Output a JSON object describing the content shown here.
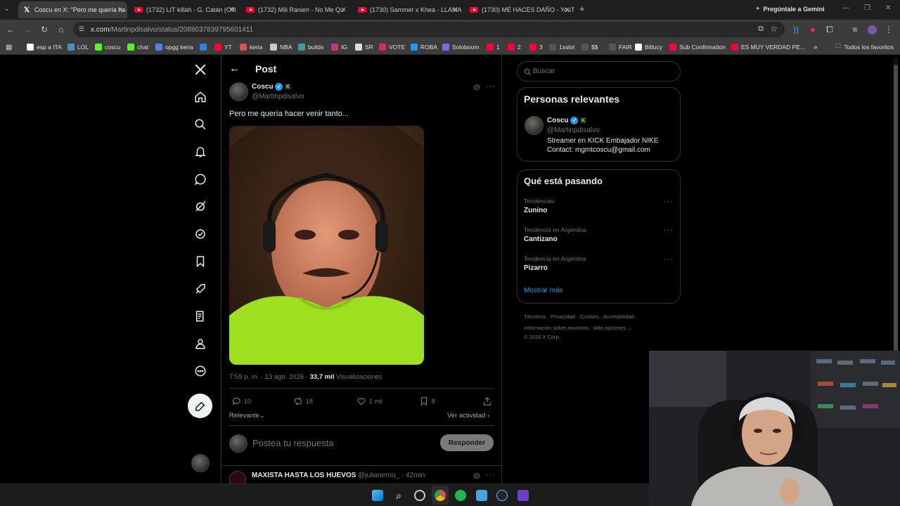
{
  "tabs": [
    {
      "title": "Coscu en X: \"Pero me quería ha",
      "icon": "x-logo-icon",
      "active": true
    },
    {
      "title": "(1732) LIT killah - G. Catán (Offi",
      "icon": "youtube-icon"
    },
    {
      "title": "(1732) Mili Ranieri - No Me Qu",
      "icon": "youtube-icon"
    },
    {
      "title": "(1730) Sammer x Khea - LLAMA",
      "icon": "youtube-icon"
    },
    {
      "title": "(1730) ME HACES DAÑO - YouT",
      "icon": "youtube-icon"
    }
  ],
  "gemini_label": "Pregúntale a Gemini",
  "url": {
    "host": "x.com",
    "path": "/Martinpdisalvo/status/2088037839795601411"
  },
  "bookmarks": [
    {
      "label": "esp a ITA",
      "color": "#ffffff"
    },
    {
      "label": "LOL",
      "color": "#4a90c2"
    },
    {
      "label": "coscu",
      "color": "#53fc18"
    },
    {
      "label": "chat",
      "color": "#53fc18"
    },
    {
      "label": "opgg keria",
      "color": "#5383e8"
    },
    {
      "label": "",
      "color": "#2f80ed"
    },
    {
      "label": "YT",
      "color": "#ff0033"
    },
    {
      "label": "keria",
      "color": "#d9534f"
    },
    {
      "label": "NBA",
      "color": "#c9c9c9"
    },
    {
      "label": "builds",
      "color": "#3aa0a0"
    },
    {
      "label": "IG",
      "color": "#c13584"
    },
    {
      "label": "SR",
      "color": "#dddddd"
    },
    {
      "label": "VOTE",
      "color": "#e0245e"
    },
    {
      "label": "ROBA",
      "color": "#1d9bf0"
    },
    {
      "label": "Soloboom",
      "color": "#7b68ee"
    },
    {
      "label": "1",
      "color": "#ff0033"
    },
    {
      "label": "2",
      "color": "#ff0033"
    },
    {
      "label": "3",
      "color": "#ff0033"
    },
    {
      "label": "1xslot",
      "color": "#555555"
    },
    {
      "label": "$$",
      "color": "#555555"
    },
    {
      "label": "FAIR",
      "color": "#555555"
    },
    {
      "label": "Bitlucy",
      "color": "#ffffff"
    },
    {
      "label": "Sub Confirmation",
      "color": "#ff0033"
    },
    {
      "label": "ES MUY VERDAD PE...",
      "color": "#ff0033"
    }
  ],
  "favorites_label": "Todos los favoritos",
  "post_header": "Post",
  "tweet": {
    "name": "Coscu",
    "handle": "@Martinpdisalvo",
    "text": "Pero me quería hacer venir tanto...",
    "time": "7:59 p. m. · 13 ago. 2026 · ",
    "views_count": "33,7 mil",
    "views_label": " Visualizaciones",
    "replies": "10",
    "reposts": "18",
    "likes": "1 mil",
    "bookmarks": "8"
  },
  "relevance_label": "Relevante",
  "activity_label": "Ver actividad",
  "reply_placeholder": "Postea tu respuesta",
  "reply_button": "Responder",
  "next_reply": {
    "name": "MAXISTA HASTA LOS HUEVOS",
    "handle": "@julianerou_",
    "time": "· 42min"
  },
  "search_placeholder": "Buscar",
  "relevant": {
    "title": "Personas relevantes",
    "name": "Coscu",
    "handle": "@Martinpdisalvo",
    "bio1": "Streamer en KICK Embajador NIKE",
    "bio2": "Contact: mgmtcoscu@gmail.com"
  },
  "trending": {
    "title": "Qué está pasando",
    "items": [
      {
        "context": "Tendencias",
        "topic": "Zunino"
      },
      {
        "context": "Tendencia en Argentina",
        "topic": "Cantizano"
      },
      {
        "context": "Tendencia en Argentina",
        "topic": "Pizarro"
      }
    ],
    "show_more": "Mostrar más"
  },
  "footer": {
    "line1": [
      "Términos",
      "Privacidad",
      "Cookies",
      "Accesibilidad"
    ],
    "line2": [
      "Información sobre anuncios",
      "Más opciones ..."
    ],
    "copyright": "© 2026 X Corp."
  }
}
